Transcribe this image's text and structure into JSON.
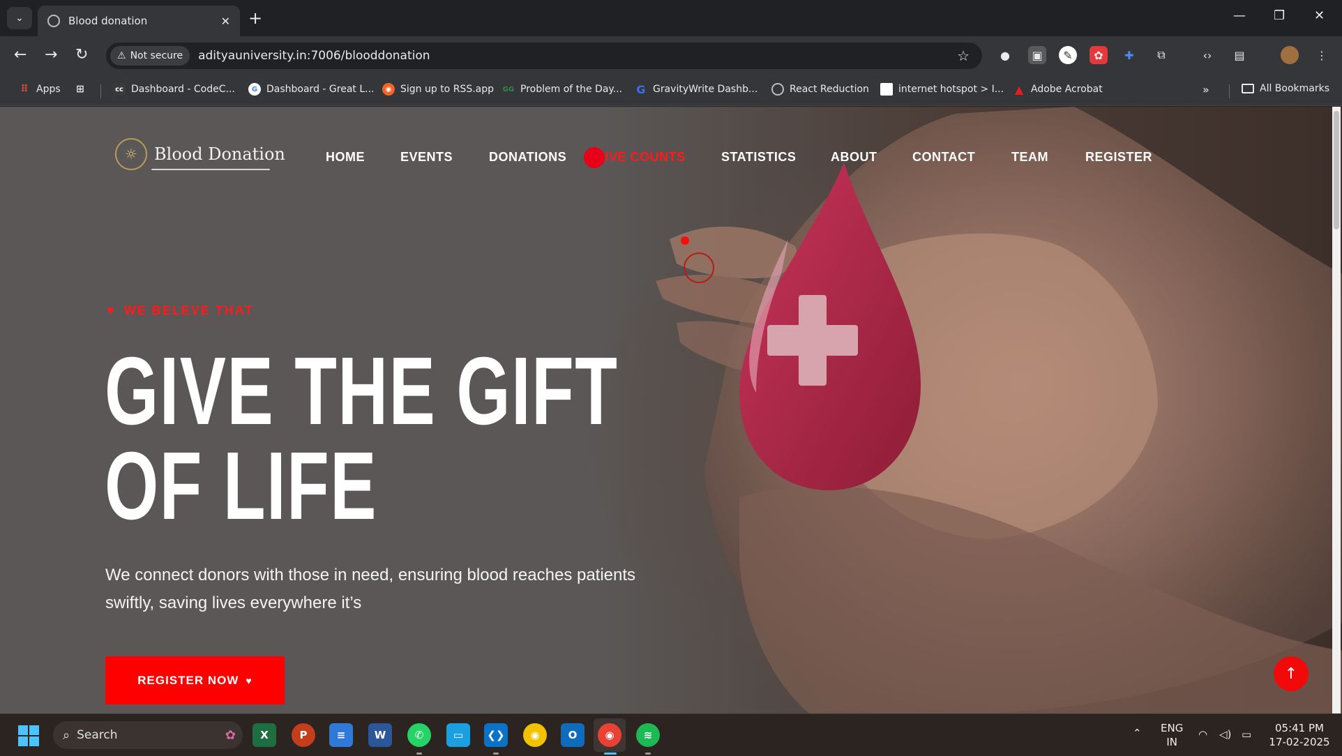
{
  "browser": {
    "tab_title": "Blood donation",
    "tab_close": "✕",
    "new_tab": "+",
    "window_controls": {
      "minimize": "—",
      "restore": "❐",
      "close": "✕"
    },
    "not_secure_label": "Not secure",
    "url": "adityauniversity.in:7006/blooddonation",
    "bookmarks": [
      {
        "label": "Apps",
        "icon": "apps-grid-icon"
      },
      {
        "label": "",
        "icon": "tab-groups-icon"
      },
      {
        "label": "Dashboard - CodeC...",
        "icon": "cc-icon"
      },
      {
        "label": "Dashboard - Great L...",
        "icon": "google-icon"
      },
      {
        "label": "Sign up to RSS.app",
        "icon": "rss-icon"
      },
      {
        "label": "Problem of the Day...",
        "icon": "gfg-icon"
      },
      {
        "label": "GravityWrite Dashb...",
        "icon": "gravitywrite-icon"
      },
      {
        "label": "React Reduction",
        "icon": "globe-icon"
      },
      {
        "label": "internet hotspot > I...",
        "icon": "page-icon"
      },
      {
        "label": "Adobe Acrobat",
        "icon": "acrobat-icon"
      }
    ],
    "bookmarks_overflow": "»",
    "all_bookmarks": "All Bookmarks"
  },
  "site": {
    "logo_text": "Blood Donation",
    "nav": [
      {
        "label": "HOME",
        "active": false
      },
      {
        "label": "EVENTS",
        "active": false
      },
      {
        "label": "DONATIONS",
        "active": false
      },
      {
        "label": "LIVE COUNTS",
        "active": true
      },
      {
        "label": "STATISTICS",
        "active": false
      },
      {
        "label": "ABOUT",
        "active": false
      },
      {
        "label": "CONTACT",
        "active": false
      },
      {
        "label": "TEAM",
        "active": false
      },
      {
        "label": "REGISTER",
        "active": false
      }
    ],
    "tagline": "WE BELEVE THAT",
    "headline_line1": "GIVE THE GIFT",
    "headline_line2": "OF LIFE",
    "subtext": "We connect donors with those in need, ensuring blood reaches patients swiftly, saving lives everywhere it’s",
    "cta_label": "REGISTER NOW",
    "colors": {
      "accent": "#ff0000",
      "nav_active": "#ff1a1a",
      "drop": "#b3233f"
    }
  },
  "taskbar": {
    "search_label": "Search",
    "apps": [
      "excel-icon",
      "powerpoint-icon",
      "notepad-icon",
      "word-icon",
      "whatsapp-icon",
      "desktop-icon",
      "vscode-icon",
      "chrome-icon",
      "outlook-icon",
      "chrome-profile-icon",
      "spotify-icon"
    ],
    "language_line1": "ENG",
    "language_line2": "IN",
    "time": "05:41 PM",
    "date": "17-02-2025"
  }
}
